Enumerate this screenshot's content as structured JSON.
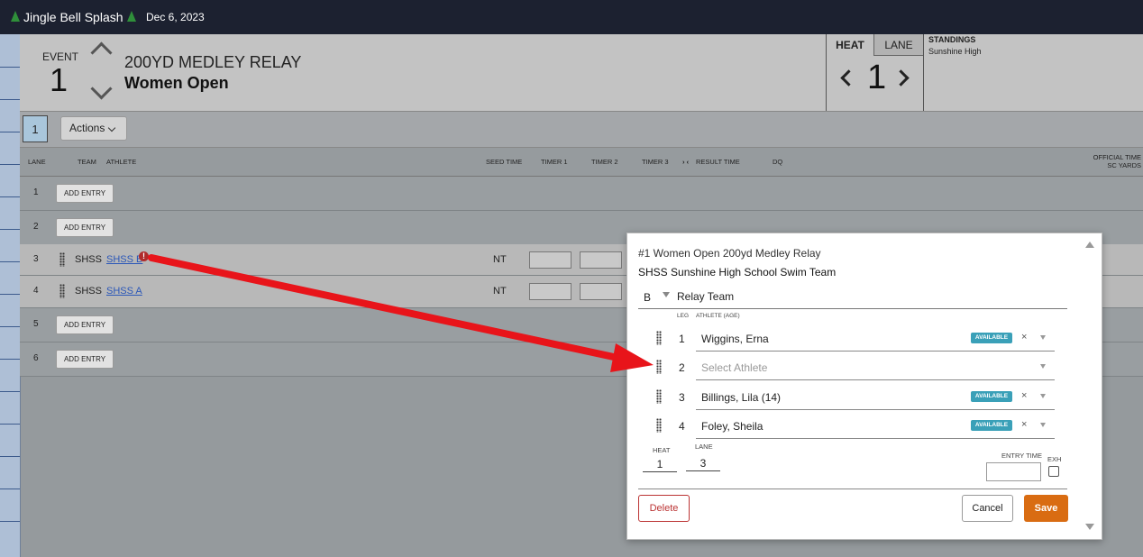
{
  "meet": {
    "name": "Jingle Bell Splash",
    "date": "Dec 6, 2023"
  },
  "event": {
    "label": "EVENT",
    "number": "1",
    "name": "200YD MEDLEY RELAY",
    "subtitle": "Women Open"
  },
  "heat_panel": {
    "heat_tab": "HEAT",
    "lane_tab": "LANE",
    "heat_number": "1"
  },
  "standings": {
    "label": "STANDINGS",
    "team": "Sunshine High"
  },
  "toolbar": {
    "heat_tab": "1",
    "actions_label": "Actions"
  },
  "columns": {
    "lane": "LANE",
    "team": "TEAM",
    "athlete": "ATHLETE",
    "seed_time": "SEED TIME",
    "timer1": "TIMER 1",
    "timer2": "TIMER 2",
    "timer3": "TIMER 3",
    "swap": "› ‹",
    "result_time": "RESULT TIME",
    "dq": "DQ",
    "official_time": "OFFICIAL TIME",
    "course": "SC YARDS"
  },
  "lanes": [
    {
      "lane": "1",
      "add_entry": "ADD ENTRY"
    },
    {
      "lane": "2",
      "add_entry": "ADD ENTRY"
    },
    {
      "lane": "3",
      "team": "SHSS",
      "relay": "SHSS B",
      "seed": "NT",
      "warning": "!"
    },
    {
      "lane": "4",
      "team": "SHSS",
      "relay": "SHSS A",
      "seed": "NT"
    },
    {
      "lane": "5",
      "add_entry": "ADD ENTRY"
    },
    {
      "lane": "6",
      "add_entry": "ADD ENTRY"
    }
  ],
  "modal": {
    "title": "#1 Women Open 200yd Medley Relay",
    "team": "SHSS Sunshine High School Swim Team",
    "relay_letter": "B",
    "relay_label": "Relay Team",
    "leg_header": "LEG",
    "athlete_header": "ATHLETE (AGE)",
    "legs": [
      {
        "leg": "1",
        "athlete": "Wiggins, Erna",
        "status": "AVAILABLE"
      },
      {
        "leg": "2",
        "placeholder": "Select Athlete"
      },
      {
        "leg": "3",
        "athlete": "Billings, Lila (14)",
        "status": "AVAILABLE"
      },
      {
        "leg": "4",
        "athlete": "Foley, Sheila",
        "status": "AVAILABLE"
      }
    ],
    "heat_label": "HEAT",
    "heat_value": "1",
    "lane_label": "LANE",
    "lane_value": "3",
    "entry_time_label": "ENTRY TIME",
    "exh_label": "EXH",
    "delete_label": "Delete",
    "cancel_label": "Cancel",
    "save_label": "Save",
    "clear_glyph": "×"
  },
  "colors": {
    "save": "#d96c12",
    "badge": "#3aa0b8",
    "annotation_arrow": "#e8141a",
    "topbar": "#1c2130"
  }
}
